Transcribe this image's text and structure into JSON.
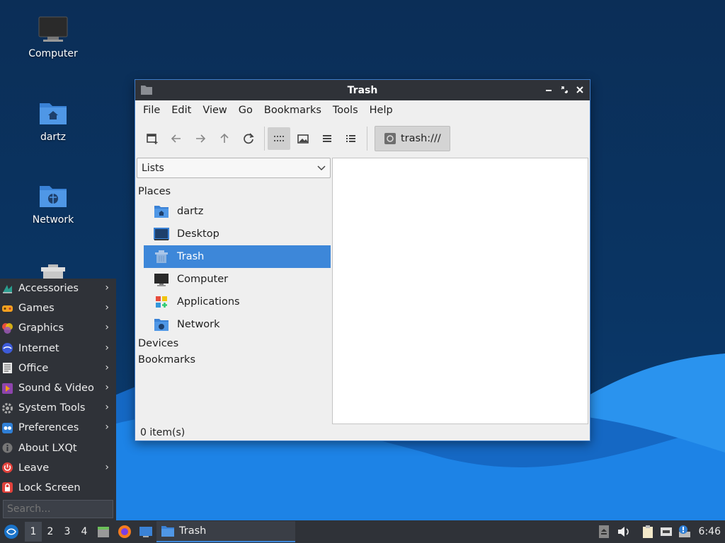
{
  "desktop": {
    "icons": [
      {
        "label": "Computer",
        "icon": "monitor-icon"
      },
      {
        "label": "dartz",
        "icon": "home-folder-icon"
      },
      {
        "label": "Network",
        "icon": "network-folder-icon"
      },
      {
        "label": "",
        "icon": "trash-icon"
      }
    ]
  },
  "window": {
    "title": "Trash",
    "menu": [
      "File",
      "Edit",
      "View",
      "Go",
      "Bookmarks",
      "Tools",
      "Help"
    ],
    "toolbar": {
      "buttons": [
        "new-tab-icon",
        "back-icon",
        "forward-icon",
        "up-icon",
        "reload-icon",
        "icon-view-icon",
        "thumbnail-view-icon",
        "compact-view-icon",
        "detailed-list-icon"
      ],
      "active_view": "icon-view-icon",
      "path": "trash:///"
    },
    "sidepane": {
      "mode": "Lists",
      "places_header": "Places",
      "places": [
        {
          "label": "dartz",
          "icon": "home-folder-icon",
          "selected": false
        },
        {
          "label": "Desktop",
          "icon": "desktop-icon",
          "selected": false
        },
        {
          "label": "Trash",
          "icon": "trash-icon",
          "selected": true
        },
        {
          "label": "Computer",
          "icon": "monitor-icon",
          "selected": false
        },
        {
          "label": "Applications",
          "icon": "applications-icon",
          "selected": false
        },
        {
          "label": "Network",
          "icon": "network-folder-icon",
          "selected": false
        }
      ],
      "devices_header": "Devices",
      "bookmarks_header": "Bookmarks"
    },
    "status": "0 item(s)"
  },
  "start_menu": {
    "items": [
      {
        "label": "Accessories",
        "icon": "accessories-icon",
        "submenu": true
      },
      {
        "label": "Games",
        "icon": "games-icon",
        "submenu": true
      },
      {
        "label": "Graphics",
        "icon": "graphics-icon",
        "submenu": true
      },
      {
        "label": "Internet",
        "icon": "internet-icon",
        "submenu": true
      },
      {
        "label": "Office",
        "icon": "office-icon",
        "submenu": true
      },
      {
        "label": "Sound & Video",
        "icon": "sound-video-icon",
        "submenu": true
      },
      {
        "label": "System Tools",
        "icon": "system-tools-icon",
        "submenu": true
      },
      {
        "label": "Preferences",
        "icon": "preferences-icon",
        "submenu": true
      },
      {
        "label": "About LXQt",
        "icon": "about-icon",
        "submenu": false
      },
      {
        "label": "Leave",
        "icon": "leave-icon",
        "submenu": true
      },
      {
        "label": "Lock Screen",
        "icon": "lock-icon",
        "submenu": false
      }
    ],
    "search_placeholder": "Search..."
  },
  "taskbar": {
    "desktops": [
      "1",
      "2",
      "3",
      "4"
    ],
    "active_desktop": "1",
    "task_label": "Trash",
    "clock": "6:46"
  },
  "colors": {
    "selection": "#3d87d9",
    "panel": "#2f3238",
    "desktop_bg": "#0b2e57",
    "wave": "#1677d8"
  }
}
